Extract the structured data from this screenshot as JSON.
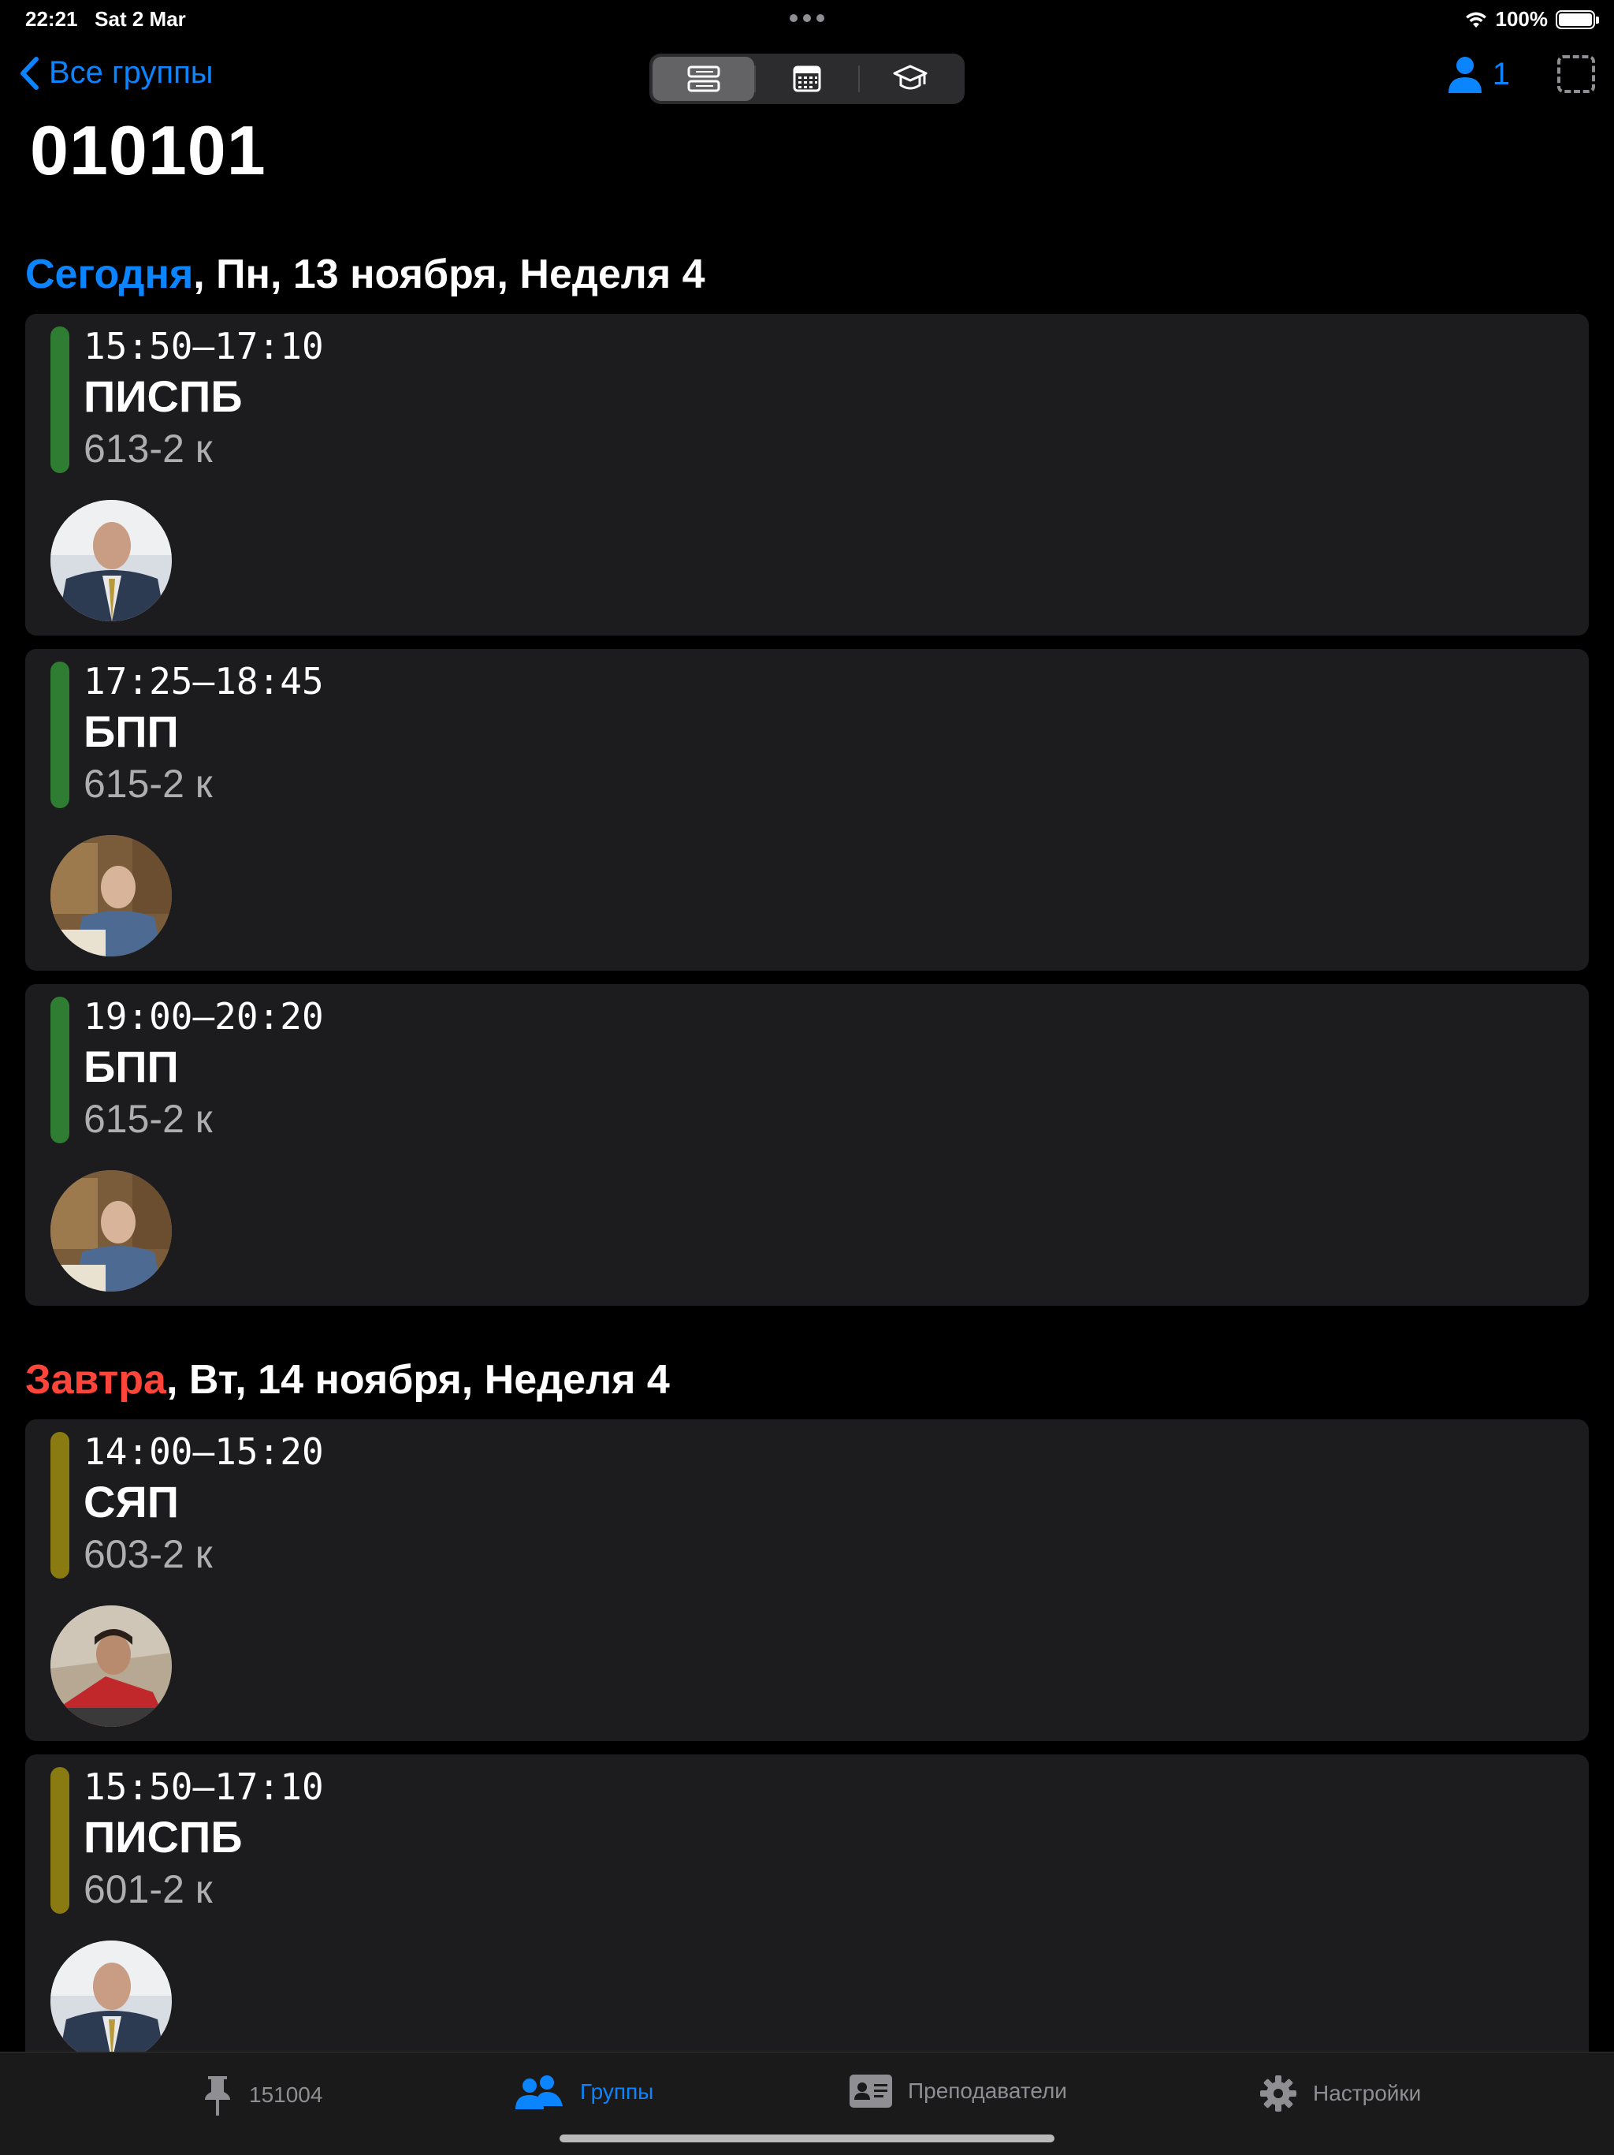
{
  "status_bar": {
    "time": "22:21",
    "date": "Sat 2 Mar",
    "battery": "100%"
  },
  "nav": {
    "back_label": "Все группы",
    "user_count": "1",
    "view_modes": [
      "list-icon",
      "calendar-icon",
      "graduation-cap-icon"
    ],
    "active_view": "list"
  },
  "title": "010101",
  "days": [
    {
      "highlight": "Сегодня",
      "rest": ", Пн, 13 ноября, Неделя 4",
      "highlight_color": "#0a84ff",
      "lessons": [
        {
          "time": "15:50—17:10",
          "subject": "ПИСПБ",
          "room": "613-2 к",
          "bar_color": "#2e7d32",
          "teacher_photo": "teacher-photo-1"
        },
        {
          "time": "17:25—18:45",
          "subject": "БПП",
          "room": "615-2 к",
          "bar_color": "#2e7d32",
          "teacher_photo": "teacher-photo-2"
        },
        {
          "time": "19:00—20:20",
          "subject": "БПП",
          "room": "615-2 к",
          "bar_color": "#2e7d32",
          "teacher_photo": "teacher-photo-2"
        }
      ]
    },
    {
      "highlight": "Завтра",
      "rest": ", Вт, 14 ноября, Неделя 4",
      "highlight_color": "#ff453a",
      "lessons": [
        {
          "time": "14:00—15:20",
          "subject": "СЯП",
          "room": "603-2 к",
          "bar_color": "#8a7a12",
          "teacher_photo": "teacher-photo-3"
        },
        {
          "time": "15:50—17:10",
          "subject": "ПИСПБ",
          "room": "601-2 к",
          "bar_color": "#8a7a12",
          "teacher_photo": "teacher-photo-1"
        }
      ]
    }
  ],
  "tabbar": {
    "items": [
      {
        "label": "151004",
        "icon": "pin-icon"
      },
      {
        "label": "Группы",
        "icon": "people-icon",
        "active": true
      },
      {
        "label": "Преподаватели",
        "icon": "id-card-icon"
      },
      {
        "label": "Настройки",
        "icon": "gear-icon"
      }
    ]
  },
  "colors": {
    "accent": "#0a84ff",
    "tomorrow": "#ff453a",
    "card_bg": "#1c1c1e"
  }
}
